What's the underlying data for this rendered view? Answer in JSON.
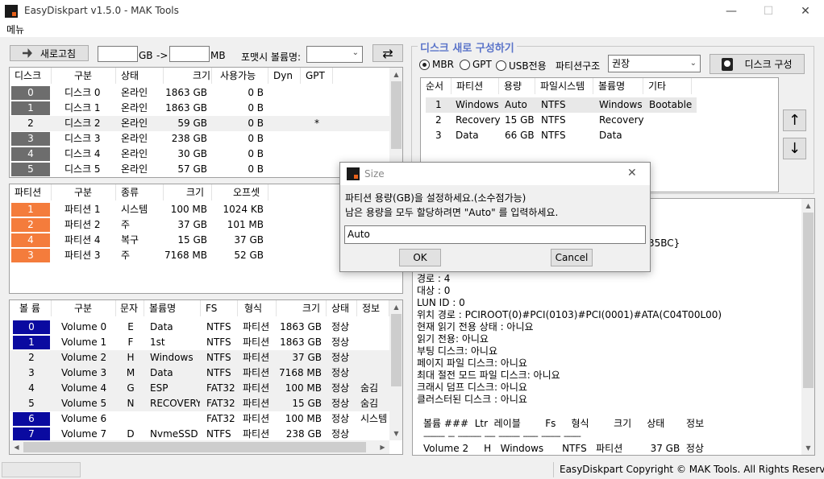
{
  "window": {
    "title": "EasyDiskpart v1.5.0 - MAK Tools",
    "minimize": "—",
    "maximize": "☐",
    "close": "✕"
  },
  "menu": {
    "label": "메뉴"
  },
  "toolbar": {
    "refresh_label": "새로고침",
    "size_from": "",
    "unit_gb": "GB",
    "arrow": "->",
    "size_to": "",
    "unit_mb": "MB",
    "volume_label_caption": "포맷시 볼륨명:",
    "volume_label_value": "",
    "swap_icon": "swap-icon"
  },
  "disks": {
    "headers": [
      "디스크",
      "구분",
      "상태",
      "크기",
      "사용가능",
      "Dyn",
      "GPT"
    ],
    "rows": [
      {
        "num": "0",
        "name": "디스크 0",
        "status": "온라인",
        "size": "1863 GB",
        "free": "0 B",
        "dyn": "",
        "gpt": "",
        "color": "#6d6d6d"
      },
      {
        "num": "1",
        "name": "디스크 1",
        "status": "온라인",
        "size": "1863 GB",
        "free": "0 B",
        "dyn": "",
        "gpt": "",
        "color": "#6d6d6d"
      },
      {
        "num": "2",
        "name": "디스크 2",
        "status": "온라인",
        "size": "59 GB",
        "free": "0 B",
        "dyn": "",
        "gpt": "*",
        "color": ""
      },
      {
        "num": "3",
        "name": "디스크 3",
        "status": "온라인",
        "size": "238 GB",
        "free": "0 B",
        "dyn": "",
        "gpt": "",
        "color": "#6d6d6d"
      },
      {
        "num": "4",
        "name": "디스크 4",
        "status": "온라인",
        "size": "30 GB",
        "free": "0 B",
        "dyn": "",
        "gpt": "",
        "color": "#6d6d6d"
      },
      {
        "num": "5",
        "name": "디스크 5",
        "status": "온라인",
        "size": "57 GB",
        "free": "0 B",
        "dyn": "",
        "gpt": "",
        "color": "#6d6d6d"
      }
    ]
  },
  "partitions": {
    "headers": [
      "파티션",
      "구분",
      "종류",
      "크기",
      "오프셋"
    ],
    "rows": [
      {
        "num": "1",
        "name": "파티션 1",
        "type": "시스템",
        "size": "100 MB",
        "offset": "1024 KB"
      },
      {
        "num": "2",
        "name": "파티션 2",
        "type": "주",
        "size": "37 GB",
        "offset": "101 MB"
      },
      {
        "num": "4",
        "name": "파티션 4",
        "type": "복구",
        "size": "15 GB",
        "offset": "37 GB"
      },
      {
        "num": "3",
        "name": "파티션 3",
        "type": "주",
        "size": "7168 MB",
        "offset": "52 GB"
      }
    ]
  },
  "volumes": {
    "headers": [
      "볼 륨",
      "구분",
      "문자",
      "볼륨명",
      "FS",
      "형식",
      "크기",
      "상태",
      "정보"
    ],
    "rows": [
      {
        "num": "0",
        "name": "Volume 0",
        "letter": "E",
        "label": "Data",
        "fs": "NTFS",
        "kind": "파티션",
        "size": "1863 GB",
        "status": "정상",
        "info": "",
        "color": "#0a0aa0"
      },
      {
        "num": "1",
        "name": "Volume 1",
        "letter": "F",
        "label": "1st",
        "fs": "NTFS",
        "kind": "파티션",
        "size": "1863 GB",
        "status": "정상",
        "info": "",
        "color": "#0a0aa0"
      },
      {
        "num": "2",
        "name": "Volume 2",
        "letter": "H",
        "label": "Windows",
        "fs": "NTFS",
        "kind": "파티션",
        "size": "37 GB",
        "status": "정상",
        "info": "",
        "color": ""
      },
      {
        "num": "3",
        "name": "Volume 3",
        "letter": "M",
        "label": "Data",
        "fs": "NTFS",
        "kind": "파티션",
        "size": "7168 MB",
        "status": "정상",
        "info": "",
        "color": ""
      },
      {
        "num": "4",
        "name": "Volume 4",
        "letter": "G",
        "label": "ESP",
        "fs": "FAT32",
        "kind": "파티션",
        "size": "100 MB",
        "status": "정상",
        "info": "숨김",
        "color": ""
      },
      {
        "num": "5",
        "name": "Volume 5",
        "letter": "N",
        "label": "RECOVERY",
        "fs": "FAT32",
        "kind": "파티션",
        "size": "15 GB",
        "status": "정상",
        "info": "숨김",
        "color": ""
      },
      {
        "num": "6",
        "name": "Volume 6",
        "letter": "",
        "label": "",
        "fs": "FAT32",
        "kind": "파티션",
        "size": "100 MB",
        "status": "정상",
        "info": "시스템",
        "color": "#0a0aa0"
      },
      {
        "num": "7",
        "name": "Volume 7",
        "letter": "D",
        "label": "NvmeSSD",
        "fs": "NTFS",
        "kind": "파티션",
        "size": "238 GB",
        "status": "정상",
        "info": "",
        "color": "#0a0aa0"
      }
    ]
  },
  "layout_group": {
    "title": "디스크 새로 구성하기",
    "mbr": "MBR",
    "gpt": "GPT",
    "usb": "USB전용",
    "structure_caption": "파티션구조",
    "structure_value": "권장",
    "configure_label": "디스크 구성",
    "table_headers": [
      "순서",
      "파티션",
      "용량",
      "파일시스템",
      "볼륨명",
      "기타"
    ],
    "table_rows": [
      {
        "order": "1",
        "part": "Windows",
        "size": "Auto",
        "fs": "NTFS",
        "label": "Windows",
        "etc": "Bootable"
      },
      {
        "order": "2",
        "part": "Recovery",
        "size": "15 GB",
        "fs": "NTFS",
        "label": "Recovery",
        "etc": ""
      },
      {
        "order": "3",
        "part": "Data",
        "size": "66 GB",
        "fs": "NTFS",
        "label": "Data",
        "etc": ""
      }
    ],
    "up": "↑",
    "down": "↓"
  },
  "info_text": {
    "partial_line": "35BC}",
    "lines": [
      "경로  : 4",
      "대상 : 0",
      "LUN ID : 0",
      "위치 경로 : PCIROOT(0)#PCI(0103)#PCI(0001)#ATA(C04T00L00)",
      "현재 읽기 전용 상태 : 아니요",
      "읽기 전용: 아니요",
      "부팅 디스크: 아니요",
      "페이지 파일 디스크: 아니요",
      "최대 절전 모드 파일 디스크: 아니요",
      "크래시 덤프 디스크: 아니요",
      "클러스터된 디스크  : 아니요"
    ],
    "vol_header": "볼륨 ###  Ltr  레이블        Fs     형식        크기     상태       정보",
    "vol_sep": "----------  ---  -----------  -----  ----------  -------  ---------  --------",
    "vol_row": "Volume 2     H   Windows      NTFS   파티션         37 GB  정상"
  },
  "dialog": {
    "title": "Size",
    "line1": "파티션 용량(GB)을 설정하세요.(소수점가능)",
    "line2": "남은 용량을 모두 할당하려면 \"Auto\" 를 입력하세요.",
    "input_value": "Auto",
    "ok": "OK",
    "cancel": "Cancel",
    "close": "✕"
  },
  "statusbar": {
    "copyright": "EasyDiskpart Copyright © MAK Tools. All Rights Reserved."
  },
  "colors": {
    "disk_badge": "#6d6d6d",
    "partition_badge": "#f47c3c",
    "volume_badge": "#0a0aa0",
    "group_title": "#5b74c9"
  }
}
